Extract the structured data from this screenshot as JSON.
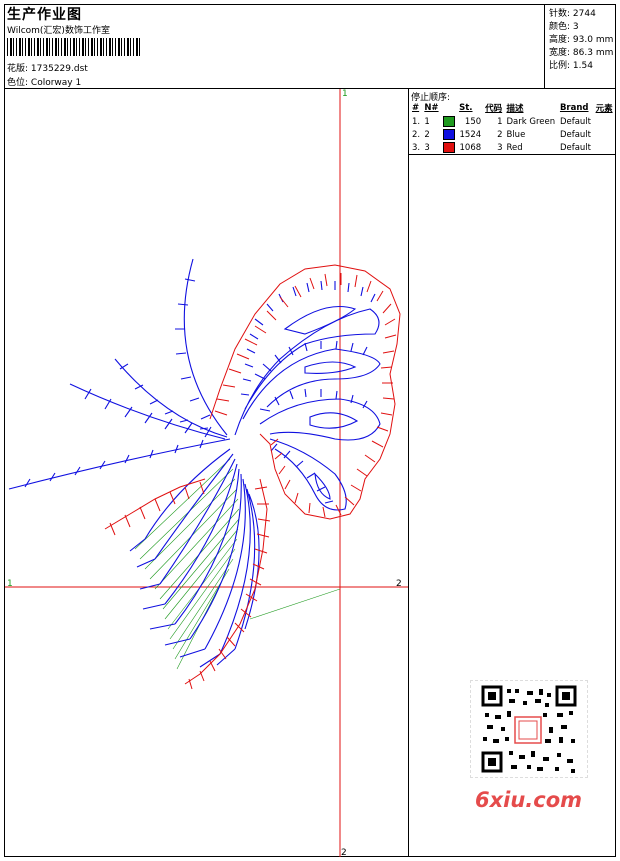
{
  "header": {
    "title": "生产作业图",
    "studio": "Wilcom(汇宏)数饰工作室",
    "design_label": "花版:",
    "design_value": "1735229.dst",
    "colorway_label": "色位:",
    "colorway_value": "Colorway 1"
  },
  "stats": [
    {
      "label": "针数:",
      "value": "2744"
    },
    {
      "label": "颜色:",
      "value": "3"
    },
    {
      "label": "高度:",
      "value": "93.0 mm"
    },
    {
      "label": "宽度:",
      "value": "86.3 mm"
    },
    {
      "label": "比例:",
      "value": "1.54"
    }
  ],
  "stop_sequence": {
    "title": "停止顺序:",
    "columns": [
      "#",
      "N#",
      "St.",
      "代码",
      "描述",
      "Brand",
      "元素"
    ],
    "rows": [
      {
        "idx": "1.",
        "n": "1",
        "color": "#1f9a1f",
        "stitches": "150",
        "code": "1",
        "desc": "Dark Green",
        "brand": "Default"
      },
      {
        "idx": "2.",
        "n": "2",
        "color": "#1010e0",
        "stitches": "1524",
        "code": "2",
        "desc": "Blue",
        "brand": "Default"
      },
      {
        "idx": "3.",
        "n": "3",
        "color": "#e01010",
        "stitches": "1068",
        "code": "3",
        "desc": "Red",
        "brand": "Default"
      }
    ]
  },
  "axes": {
    "top": "1",
    "left": "1",
    "right": "2",
    "bottom": "2"
  },
  "colors": {
    "axis": "#e01010",
    "green": "#1f9a1f",
    "blue": "#1010e0",
    "red": "#e01010"
  },
  "watermark": "6xiu.com"
}
